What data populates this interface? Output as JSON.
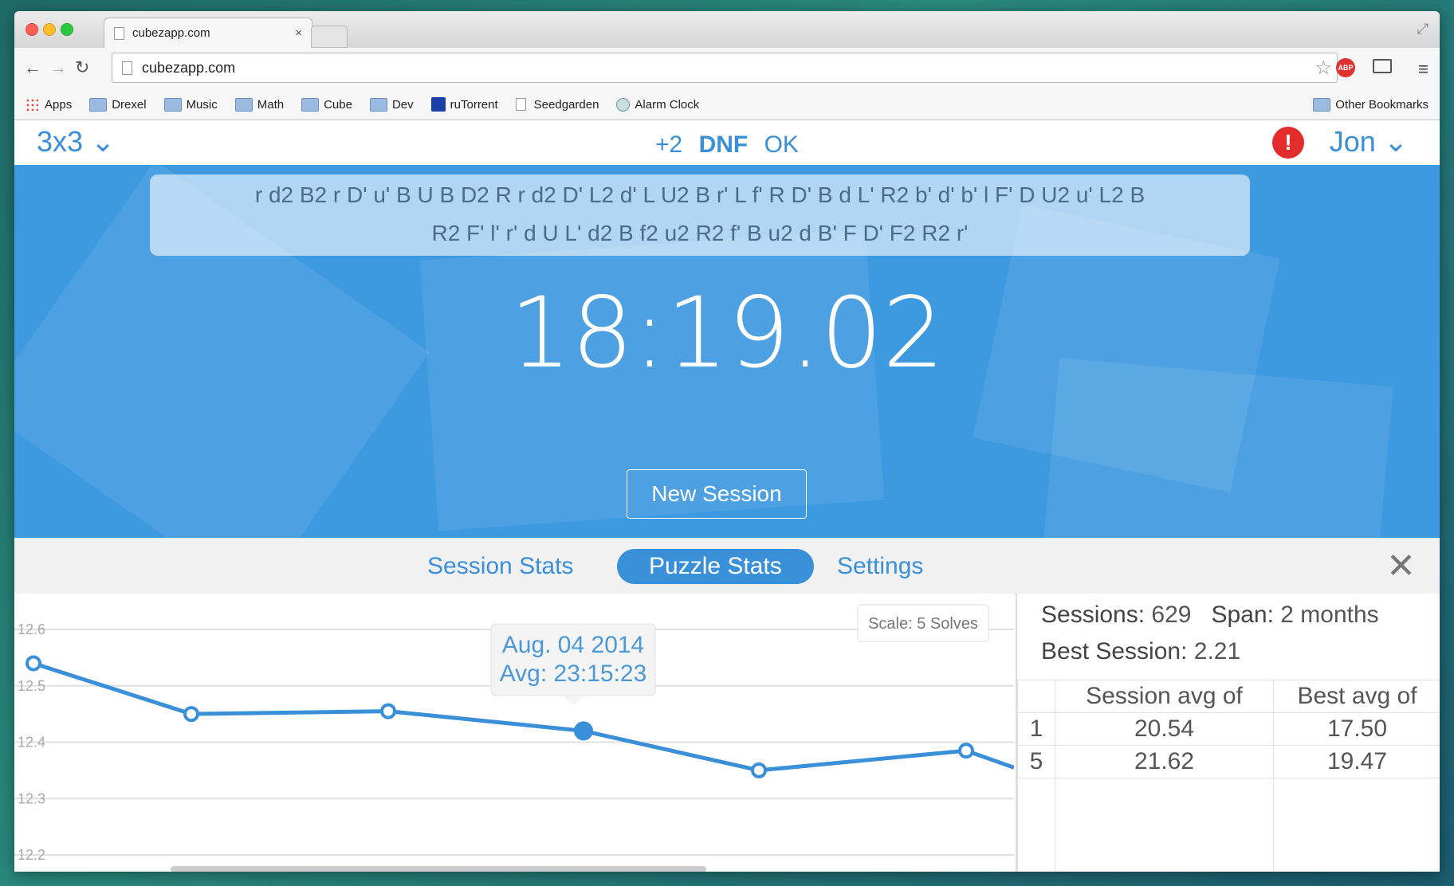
{
  "browser": {
    "tab_title": "cubezapp.com",
    "tab_close": "×",
    "url": "cubezapp.com",
    "nav": {
      "back": "←",
      "forward": "→",
      "reload": "↻"
    },
    "icons": {
      "star": "☆",
      "abp": "ABP",
      "menu": "≡",
      "fullscreen": "⤢"
    },
    "bookmarks": [
      "Apps",
      "Drexel",
      "Music",
      "Math",
      "Cube",
      "Dev",
      "ruTorrent",
      "Seedgarden",
      "Alarm Clock"
    ],
    "other_bookmarks": "Other Bookmarks"
  },
  "app": {
    "puzzle": "3x3 ⌄",
    "penalties": {
      "plus2": "+2",
      "dnf": "DNF",
      "ok": "OK"
    },
    "alert": "!",
    "user": "Jon ⌄",
    "scramble_line1": "r d2 B2 r D' u' B U B D2 R r d2 D' L2 d' L U2 B r' L f' R D' B d L' R2 b' d' b' l F' D U2 u' L2 B",
    "scramble_line2": "R2 F' l' r' d U L' d2 B f2 u2 R2 f' B u2 d B' F D' F2 R2 r'",
    "timer": "18:19.02",
    "new_session": "New Session",
    "tabs": {
      "session": "Session Stats",
      "puzzle": "Puzzle Stats",
      "settings": "Settings"
    },
    "close": "✕",
    "scale": "Scale: 5 Solves",
    "tooltip": {
      "date": "Aug. 04 2014",
      "avg": "Avg: 23:15:23"
    },
    "summary": {
      "sessions_label": "Sessions:",
      "sessions": "629",
      "span_label": "Span:",
      "span": "2 months",
      "best_label": "Best Session:",
      "best": "2.21"
    },
    "table": {
      "headers": [
        "",
        "Session avg of",
        "Best avg of"
      ],
      "rows": [
        [
          "1",
          "20.54",
          "17.50"
        ],
        [
          "5",
          "21.62",
          "19.47"
        ]
      ]
    }
  },
  "chart_data": {
    "type": "line",
    "y_ticks": [
      "12.6",
      "12.5",
      "12.4",
      "12.3",
      "12.2"
    ],
    "ylim": [
      12.2,
      12.6
    ],
    "series": [
      {
        "values": [
          12.54,
          12.45,
          12.455,
          12.42,
          12.35,
          12.385,
          12.355
        ]
      }
    ]
  }
}
